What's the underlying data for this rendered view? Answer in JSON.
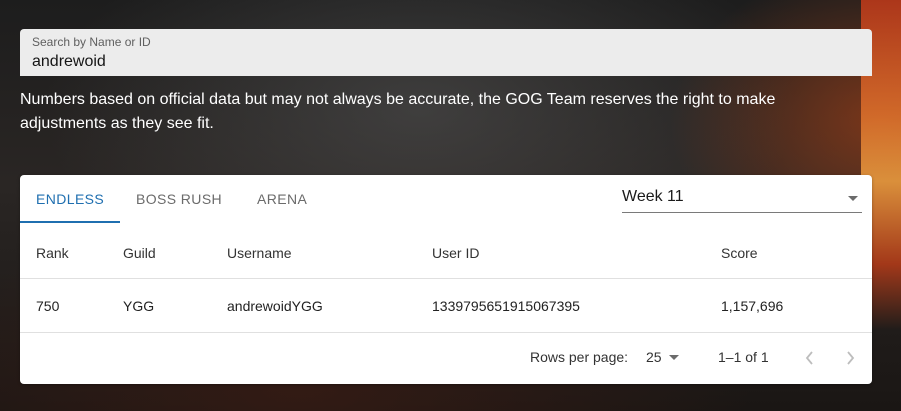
{
  "search": {
    "label": "Search by Name or ID",
    "value": "andrewoid"
  },
  "disclaimer": "Numbers based on official data but may not always be accurate, the GOG Team reserves the right to make adjustments as they see fit.",
  "tabs": [
    {
      "label": "ENDLESS",
      "active": true
    },
    {
      "label": "BOSS RUSH",
      "active": false
    },
    {
      "label": "ARENA",
      "active": false
    }
  ],
  "week_select": {
    "value": "Week 11",
    "icon": "chevron-down-icon"
  },
  "table": {
    "headers": [
      "Rank",
      "Guild",
      "Username",
      "User ID",
      "Score"
    ],
    "rows": [
      [
        "750",
        "YGG",
        "andrewoidYGG",
        "1339795651915067395",
        "1,157,696"
      ]
    ]
  },
  "pagination": {
    "rows_per_page_label": "Rows per page:",
    "rows_per_page_value": "25",
    "range": "1–1 of 1",
    "prev_icon": "chevron-left-icon",
    "next_icon": "chevron-right-icon"
  },
  "colors": {
    "accent": "#1f6fb0",
    "search_bg": "#ececec"
  }
}
